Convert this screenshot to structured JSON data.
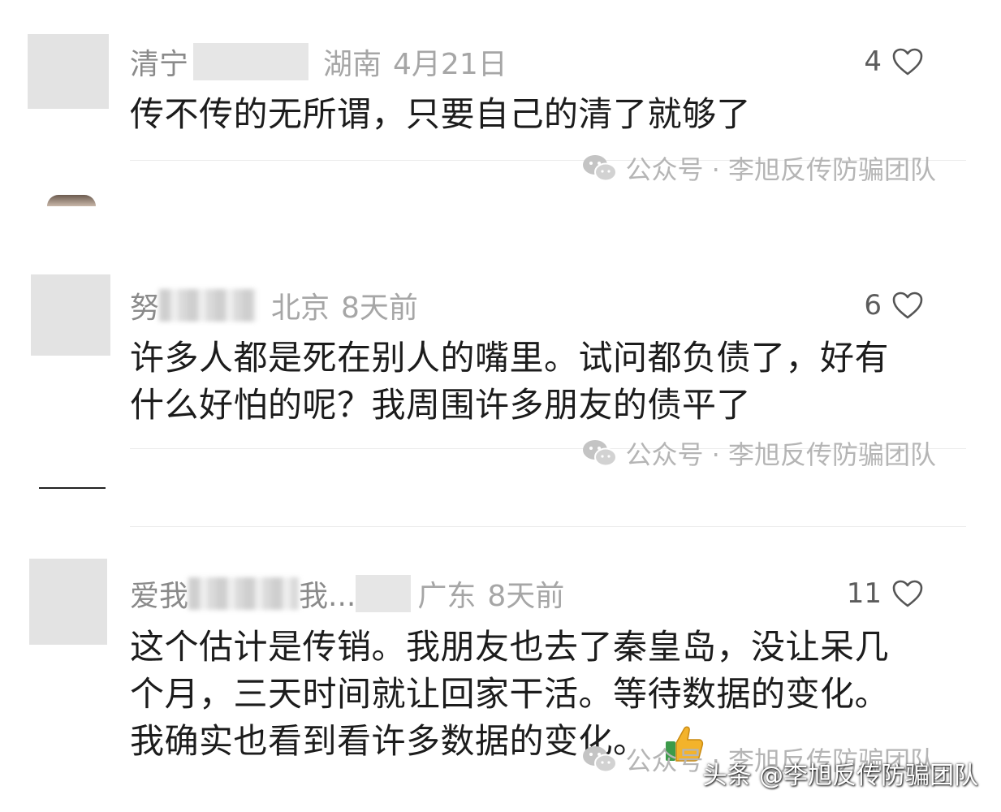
{
  "comments": [
    {
      "name": "清宁",
      "region": "湖南",
      "date": "4月21日",
      "likes": "4",
      "lines": [
        "传不传的无所谓，只要自己的清了就够了"
      ]
    },
    {
      "name": "努",
      "region": "北京",
      "date": "8天前",
      "likes": "6",
      "lines": [
        "许多人都是死在别人的嘴里。试问都负债了，好有",
        "什么好怕的呢？我周围许多朋友的债平了"
      ]
    },
    {
      "name": "爱我",
      "name_mid": "我...",
      "region": "广东",
      "date": "8天前",
      "likes": "11",
      "lines": [
        "这个估计是传销。我朋友也去了秦皇岛，没让呆几",
        "个月，三天时间就让回家干活。等待数据的变化。",
        "我确实也看到看许多数据的变化。"
      ]
    }
  ],
  "watermark": {
    "text": "公众号 · 李旭反传防骗团队",
    "icon": "wechat-icon"
  },
  "footer_watermark": "头条 @李旭反传防骗团队",
  "icons": {
    "like": "heart-outline-icon",
    "emoji": "thumbs-up-emoji"
  }
}
